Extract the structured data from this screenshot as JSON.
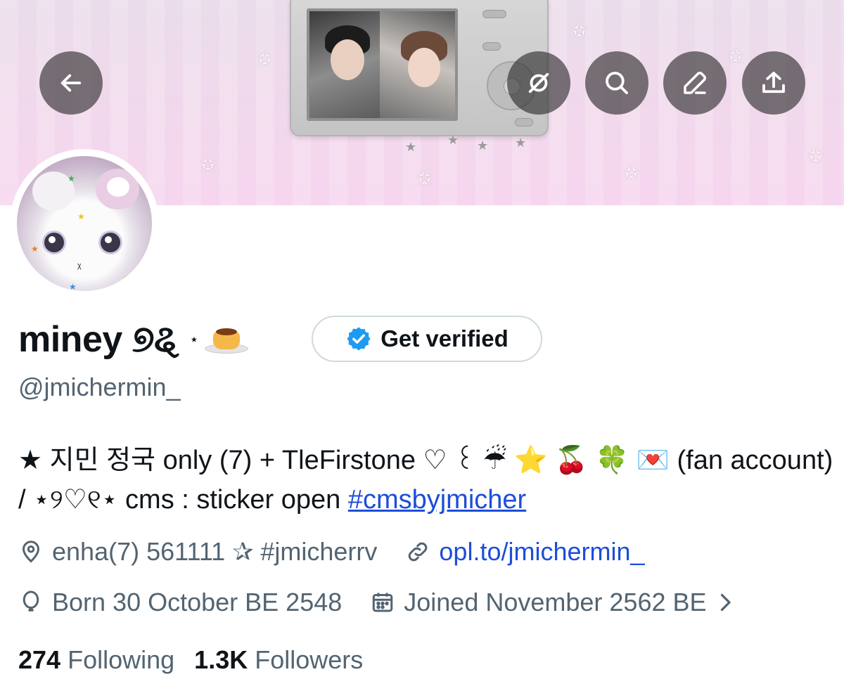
{
  "banner": {
    "buttons": {
      "back": "back-arrow-icon",
      "grok": "grok-icon",
      "search": "search-icon",
      "edit": "edit-icon",
      "share": "share-icon"
    }
  },
  "profile": {
    "display_name": "miney ୭ୡ",
    "name_suffix": "⋆",
    "handle": "@jmichermin_",
    "verify_label": "Get verified",
    "bio_text": "★ 지민 정국 only (7) + TleFirstone ♡ ꒰ ☔ ⭐ 🍒 🍀 💌 (fan account) / ⋆୨♡୧⋆ cms : sticker open ",
    "bio_hashtag": "#cmsbyjmicher",
    "location": "enha(7) 561111 ✰ #jmicherrv",
    "website": "opl.to/jmichermin_",
    "birthday": "Born 30 October BE 2548",
    "joined": "Joined November 2562 BE",
    "following_count": "274",
    "following_label": "Following",
    "followers_count": "1.3K",
    "followers_label": "Followers"
  },
  "colors": {
    "accent_link": "#1d4ed8",
    "verified_blue": "#1d9bf0",
    "secondary_text": "#536471",
    "primary_text": "#0f1419"
  }
}
